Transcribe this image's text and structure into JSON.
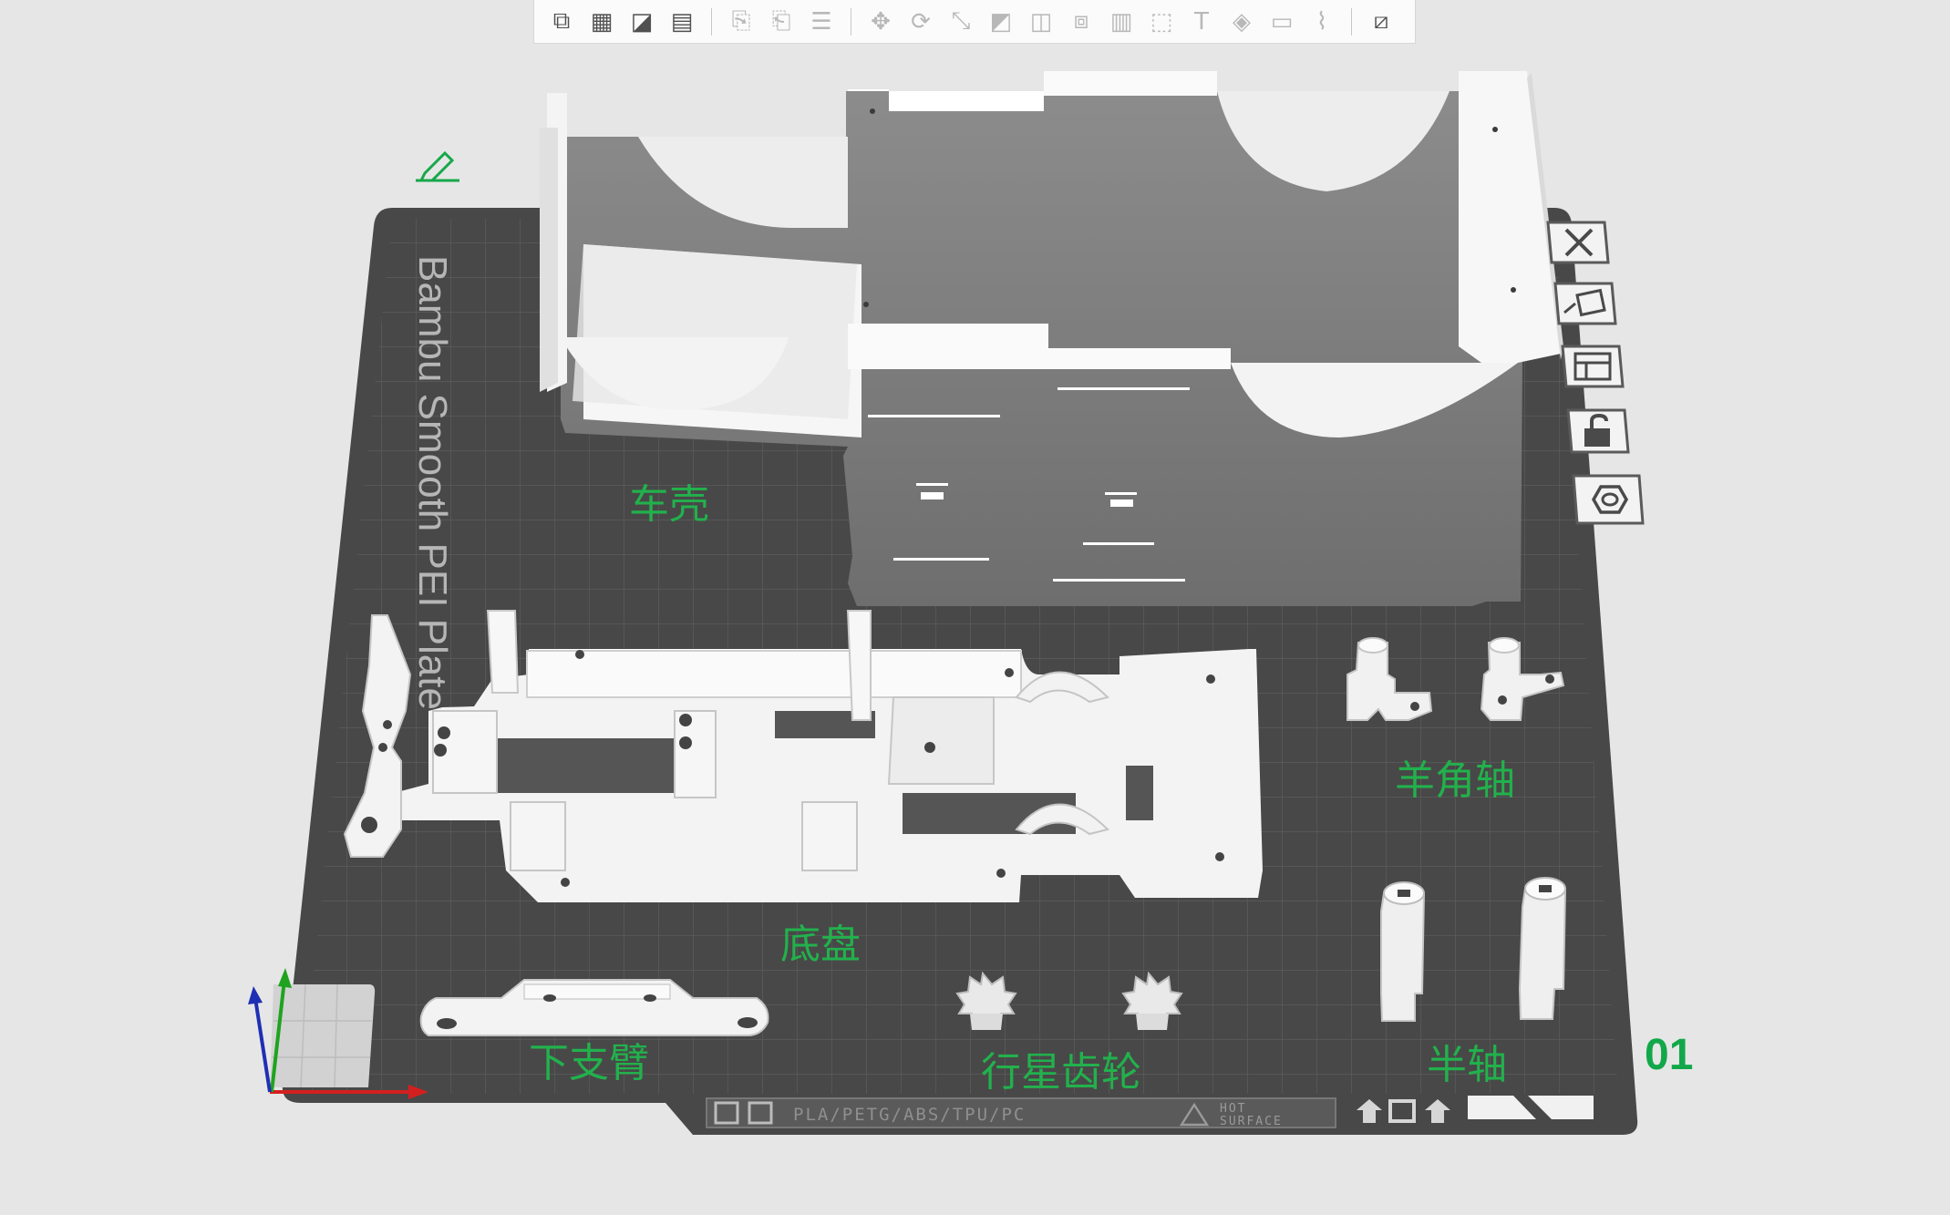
{
  "toolbar": {
    "groups": [
      [
        "add-cube-icon",
        "grid-add-icon",
        "auto-orient-icon",
        "arrange-icon"
      ],
      [
        "copy-icon",
        "paste-icon",
        "layers-icon"
      ],
      [
        "move-icon",
        "rotate-icon",
        "scale-icon",
        "lay-on-face-icon",
        "split-icon",
        "boolean-icon",
        "support-paint-icon",
        "cube-cut-icon",
        "text-tool-icon",
        "paint-bucket-icon",
        "measure-icon",
        "seam-paint-icon"
      ],
      [
        "assembly-icon"
      ]
    ],
    "dimmed": [
      "copy-icon",
      "paste-icon",
      "layers-icon",
      "move-icon",
      "rotate-icon",
      "scale-icon",
      "lay-on-face-icon",
      "split-icon",
      "boolean-icon",
      "support-paint-icon",
      "cube-cut-icon",
      "text-tool-icon",
      "paint-bucket-icon",
      "measure-icon",
      "seam-paint-icon"
    ]
  },
  "plate": {
    "brand_text": "Bambu Smooth PEI Plate",
    "strip_text": "PLA/PETG/ABS/TPU/PC",
    "hot_text_1": "HOT",
    "hot_text_2": "SURFACE",
    "plate_number": "01"
  },
  "labels": {
    "body": "车壳",
    "chassis": "底盘",
    "knuckle": "羊角轴",
    "lower_arm": "下支臂",
    "planet_gear": "行星齿轮",
    "half_shaft": "半轴"
  },
  "side_toolbar": [
    "delete-plate-icon",
    "auto-arrange-icon",
    "plate-settings-icon",
    "lock-icon",
    "hexagon-settings-icon"
  ],
  "colors": {
    "background": "#e6e6e6",
    "plate": "#4b4b4b",
    "grid": "#5f5f5f",
    "model": "#f4f4f4",
    "label": "#22b14c"
  }
}
